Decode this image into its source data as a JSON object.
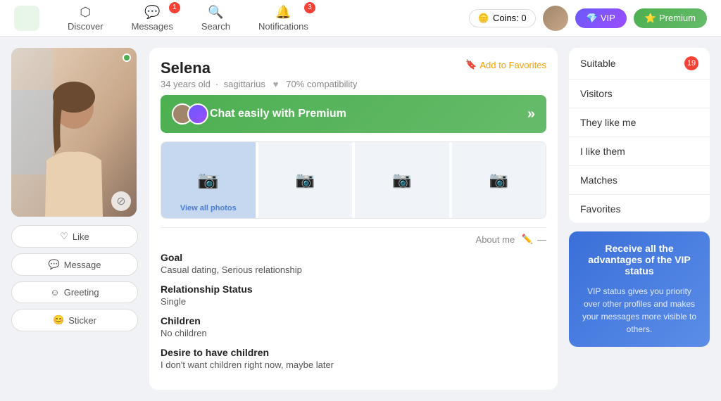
{
  "header": {
    "nav": [
      {
        "id": "discover",
        "label": "Discover",
        "icon": "🔷",
        "badge": null,
        "active": false
      },
      {
        "id": "messages",
        "label": "Messages",
        "icon": "💬",
        "badge": "1",
        "active": false
      },
      {
        "id": "search",
        "label": "Search",
        "icon": "🔍",
        "badge": null,
        "active": false
      },
      {
        "id": "notifications",
        "label": "Notifications",
        "icon": "🔔",
        "badge": "3",
        "active": false
      }
    ],
    "coins_label": "Coins: 0",
    "vip_label": "VIP",
    "premium_label": "Premium"
  },
  "profile": {
    "name": "Selena",
    "age": "34 years old",
    "sign": "sagittarius",
    "compatibility": "70% compatibility",
    "add_favorites": "Add to Favorites",
    "chat_premium": "Chat easily with Premium",
    "view_all_photos": "View all photos",
    "about_me": "About me",
    "online_status": "online",
    "goal_label": "Goal",
    "goal_value": "Casual dating, Serious relationship",
    "relationship_label": "Relationship Status",
    "relationship_value": "Single",
    "children_label": "Children",
    "children_value": "No children",
    "desire_children_label": "Desire to have children",
    "desire_children_value": "I don't want children right now, maybe later"
  },
  "actions": {
    "like": "Like",
    "message": "Message",
    "greeting": "Greeting",
    "sticker": "Sticker"
  },
  "sidebar": {
    "items": [
      {
        "id": "suitable",
        "label": "Suitable",
        "badge": "19"
      },
      {
        "id": "visitors",
        "label": "Visitors",
        "badge": null
      },
      {
        "id": "they-like-me",
        "label": "They like me",
        "badge": null
      },
      {
        "id": "i-like-them",
        "label": "I like them",
        "badge": null
      },
      {
        "id": "matches",
        "label": "Matches",
        "badge": null
      },
      {
        "id": "favorites",
        "label": "Favorites",
        "badge": null
      }
    ],
    "vip_title": "Receive all the advantages of the VIP status",
    "vip_body": "VIP status gives you priority over other profiles and makes your messages more visible to others."
  }
}
